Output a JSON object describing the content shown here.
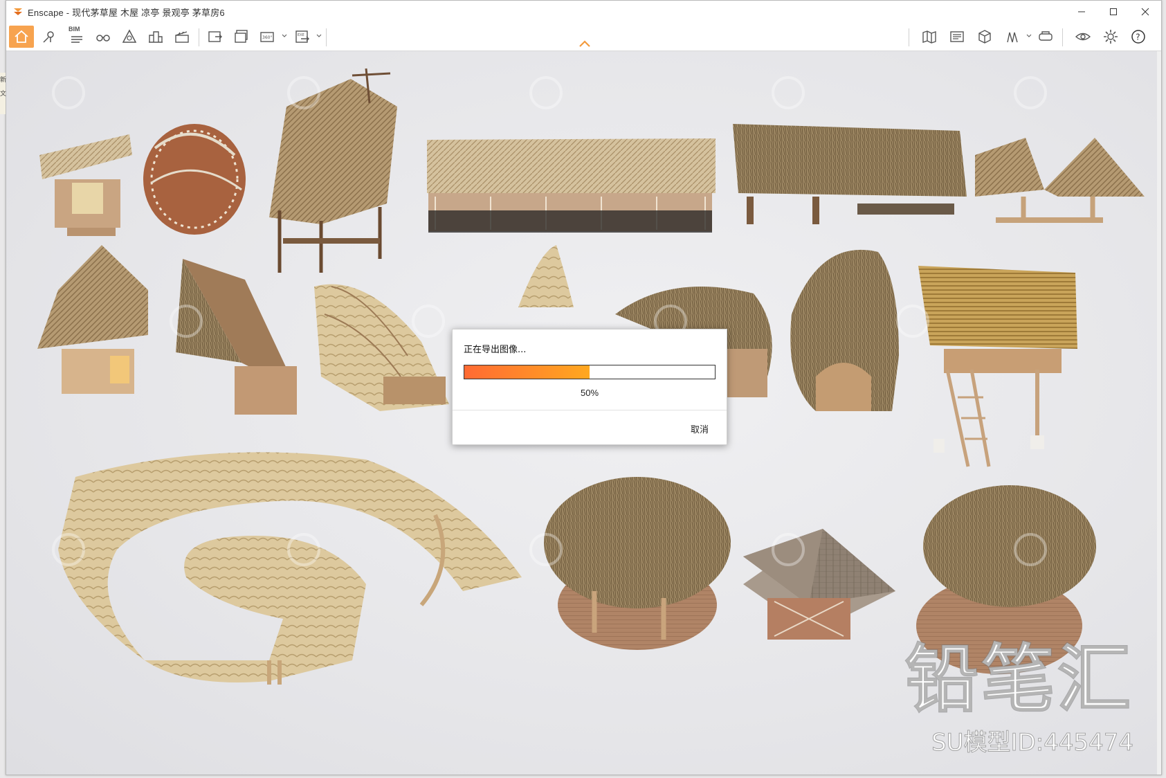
{
  "window": {
    "title": "Enscape - 现代茅草屋 木屋 凉亭 景观亭 茅草房6",
    "accent": "#f39a3d"
  },
  "toolbar": {
    "items": [
      {
        "name": "home",
        "icon": "home-icon"
      },
      {
        "name": "views",
        "icon": "location-icon"
      },
      {
        "name": "bim",
        "icon": "bim-list-icon",
        "label": "BIM"
      },
      {
        "name": "binoculars",
        "icon": "binoculars-icon"
      },
      {
        "name": "assets",
        "icon": "asset-library-icon"
      },
      {
        "name": "city",
        "icon": "buildings-icon"
      },
      {
        "name": "video",
        "icon": "clapper-icon"
      },
      {
        "name": "screenshot",
        "icon": "screenshot-export-icon"
      },
      {
        "name": "batch",
        "icon": "batch-render-icon"
      },
      {
        "name": "panorama",
        "icon": "panorama-360-icon",
        "label": "360°"
      },
      {
        "name": "exe",
        "icon": "exe-export-icon",
        "label": "EXE"
      },
      {
        "name": "map",
        "icon": "map-icon"
      },
      {
        "name": "atlas",
        "icon": "atlas-icon"
      },
      {
        "name": "cube",
        "icon": "cube-icon"
      },
      {
        "name": "collab",
        "icon": "walk-icon"
      },
      {
        "name": "vr",
        "icon": "vr-headset-icon"
      },
      {
        "name": "visibility",
        "icon": "eye-icon"
      },
      {
        "name": "settings",
        "icon": "gear-icon"
      },
      {
        "name": "help",
        "icon": "help-icon",
        "label": "?"
      }
    ]
  },
  "side_strip": {
    "line1": "新",
    "line2": "文"
  },
  "dialog": {
    "title": "正在导出图像...",
    "progress": 0.5,
    "percent_label": "50%",
    "cancel_label": "取消",
    "colors": {
      "fill_start": "#ff6a33",
      "fill_end": "#ffa820"
    }
  },
  "watermark": {
    "brand": "铅笔汇",
    "id_label": "SU模型ID:445474"
  }
}
